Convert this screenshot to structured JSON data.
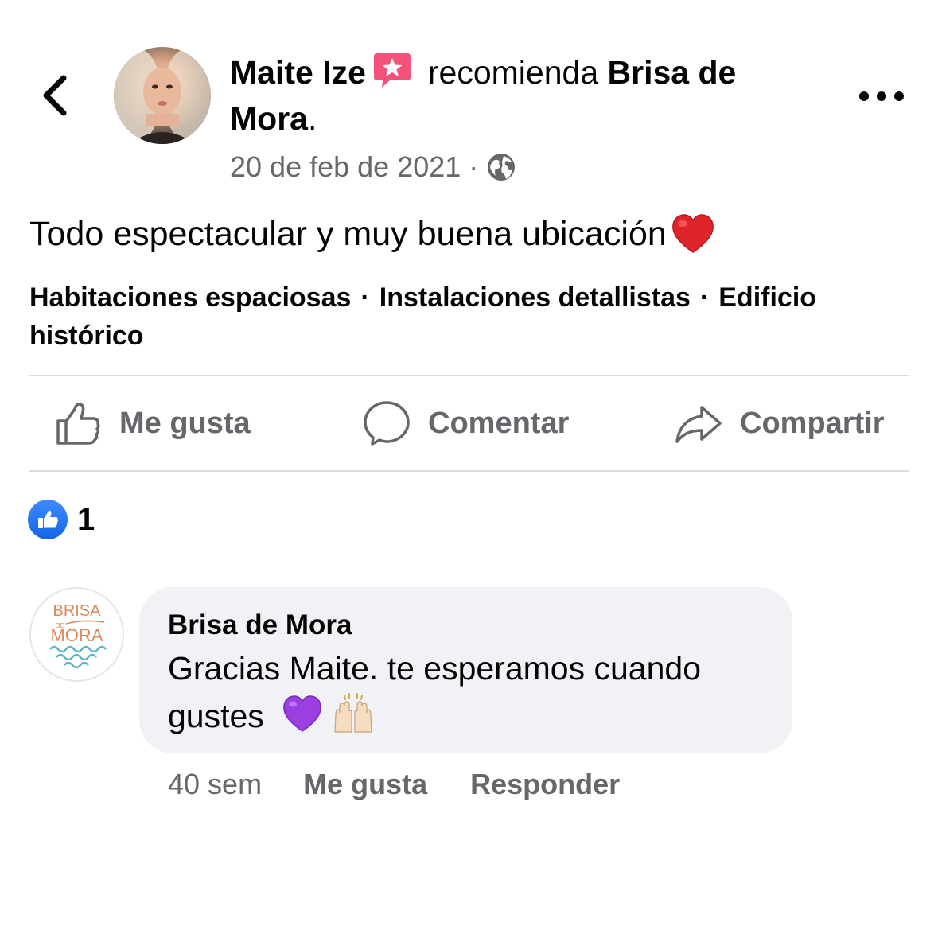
{
  "header": {
    "author_name": "Maite Ize",
    "verb": "recomienda",
    "page_name": "Brisa de Mora",
    "period": ".",
    "date": "20 de feb de 2021",
    "dot": "·",
    "audience_icon": "globe-icon",
    "badge_icon": "recommendation-star-icon",
    "back_icon": "chevron-left-icon",
    "more_icon": "more-horizontal-icon"
  },
  "post": {
    "text": "Todo espectacular y muy buena ubicación",
    "emoji": "red-heart-emoji",
    "tags": [
      "Habitaciones espaciosas",
      "Instalaciones detallistas",
      "Edificio histórico"
    ],
    "tag_separator": "·"
  },
  "actions": {
    "like": "Me gusta",
    "comment": "Comentar",
    "share": "Compartir"
  },
  "reactions": {
    "icon": "like-reaction-icon",
    "count": "1"
  },
  "comment": {
    "author": "Brisa de Mora",
    "text": "Gracias Maite. te esperamos cuando gustes",
    "emojis": [
      "purple-heart-emoji",
      "raising-hands-emoji"
    ],
    "logo_text": {
      "line1": "BRISA",
      "line2": "DE",
      "line3": "MORA"
    },
    "time": "40 sem",
    "like_label": "Me gusta",
    "reply_label": "Responder"
  },
  "colors": {
    "text_primary": "#050505",
    "text_secondary": "#65676b",
    "divider": "#dadde1",
    "bubble_bg": "#f0f2f5",
    "like_blue": "#1877f2",
    "badge_pink": "#f4517b",
    "logo_orange": "#d98c5f",
    "logo_teal": "#5bb4c9"
  }
}
